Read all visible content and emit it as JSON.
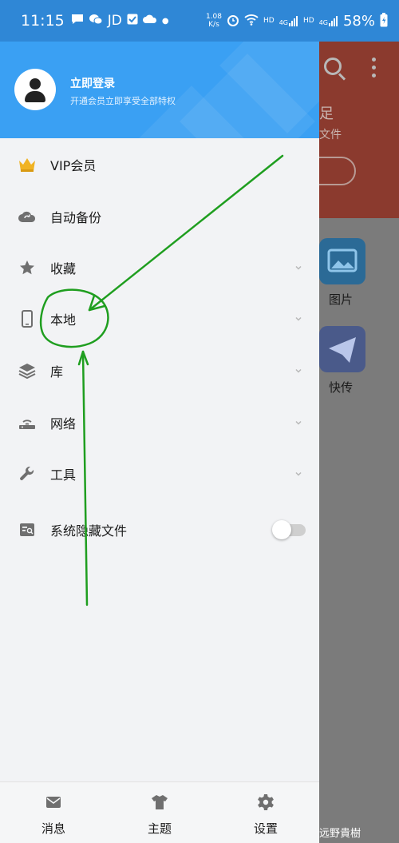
{
  "status_bar": {
    "time": "11:15",
    "carrier_label": "JD",
    "net_speed_value": "1.08",
    "net_speed_unit": "K/s",
    "hd1": "HD",
    "signal_tag": "4G",
    "hd2": "HD",
    "signal_tag2": "4G",
    "battery": "58%"
  },
  "drawer": {
    "login_title": "立即登录",
    "login_subtitle": "开通会员立即享受全部特权",
    "items": [
      {
        "label": "VIP会员",
        "icon": "crown-icon",
        "expandable": false
      },
      {
        "label": "自动备份",
        "icon": "cloud-sync-icon",
        "expandable": false
      },
      {
        "label": "收藏",
        "icon": "star-icon",
        "expandable": true
      },
      {
        "label": "本地",
        "icon": "phone-icon",
        "expandable": true
      },
      {
        "label": "库",
        "icon": "layers-icon",
        "expandable": true
      },
      {
        "label": "网络",
        "icon": "router-icon",
        "expandable": true
      },
      {
        "label": "工具",
        "icon": "wrench-icon",
        "expandable": true
      },
      {
        "label": "系统隐藏文件",
        "icon": "hidden-file-icon",
        "toggle": false
      }
    ]
  },
  "bottom_bar": {
    "items": [
      {
        "label": "消息",
        "icon": "mail-icon"
      },
      {
        "label": "主题",
        "icon": "shirt-icon"
      },
      {
        "label": "设置",
        "icon": "gear-icon"
      }
    ]
  },
  "background_app": {
    "header_text_1": "足",
    "header_text_2": "文件",
    "grid_labels": [
      "图片",
      "快传"
    ]
  },
  "watermark": "远野貴樹",
  "colors": {
    "status_bar": "#2f87d6",
    "drawer_header": "#3aa0f3",
    "drawer_bg": "#f2f3f5",
    "annotation": "#1f9e1f",
    "crown": "#f0b323"
  }
}
